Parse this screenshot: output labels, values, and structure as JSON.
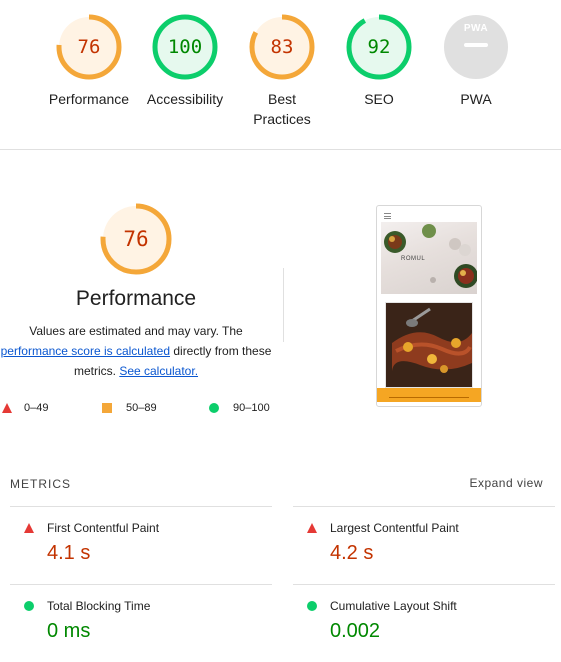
{
  "colors": {
    "fail": "#c33300",
    "fail_ring": "#e53935",
    "average": "#c33300",
    "average_ring": "#f4a739",
    "average_bg": "#fff3e4",
    "pass": "#008800",
    "pass_ring": "#0cce6b",
    "pass_bg": "#e6f9ee",
    "na_bg": "#e0e0e0",
    "link": "#0b57d0"
  },
  "summary_gauges": [
    {
      "score": "76",
      "label": "Performance",
      "status": "average",
      "fraction": 0.76
    },
    {
      "score": "100",
      "label": "Accessibility",
      "status": "pass",
      "fraction": 1.0
    },
    {
      "score": "83",
      "label": "Best Practices",
      "label_line1": "Best",
      "label_line2": "Practices",
      "status": "average",
      "fraction": 0.83
    },
    {
      "score": "92",
      "label": "SEO",
      "status": "pass",
      "fraction": 0.92
    },
    {
      "score": "PWA",
      "label": "PWA",
      "status": "na"
    }
  ],
  "performance": {
    "score": "76",
    "fraction": 0.76,
    "title": "Performance",
    "desc_part1": "Values are estimated and may vary. The",
    "link1": "performance score is calculated",
    "desc_part2": " directly from these",
    "desc_part3": "metrics. ",
    "link2": "See calculator."
  },
  "legend": [
    {
      "icon": "triangle-fail-icon",
      "label": "0–49"
    },
    {
      "icon": "square-average-icon",
      "label": "50–89"
    },
    {
      "icon": "circle-pass-icon",
      "label": "90–100"
    }
  ],
  "screenshot": {
    "brand": "ROMUL"
  },
  "metrics": {
    "heading": "METRICS",
    "expand_label": "Expand view",
    "items": [
      {
        "title": "First Contentful Paint",
        "value": "4.1 s",
        "status": "fail",
        "icon": "triangle-fail-icon"
      },
      {
        "title": "Largest Contentful Paint",
        "value": "4.2 s",
        "status": "fail",
        "icon": "triangle-fail-icon"
      },
      {
        "title": "Total Blocking Time",
        "value": "0 ms",
        "status": "pass",
        "icon": "circle-pass-icon"
      },
      {
        "title": "Cumulative Layout Shift",
        "value": "0.002",
        "status": "pass",
        "icon": "circle-pass-icon"
      }
    ]
  }
}
